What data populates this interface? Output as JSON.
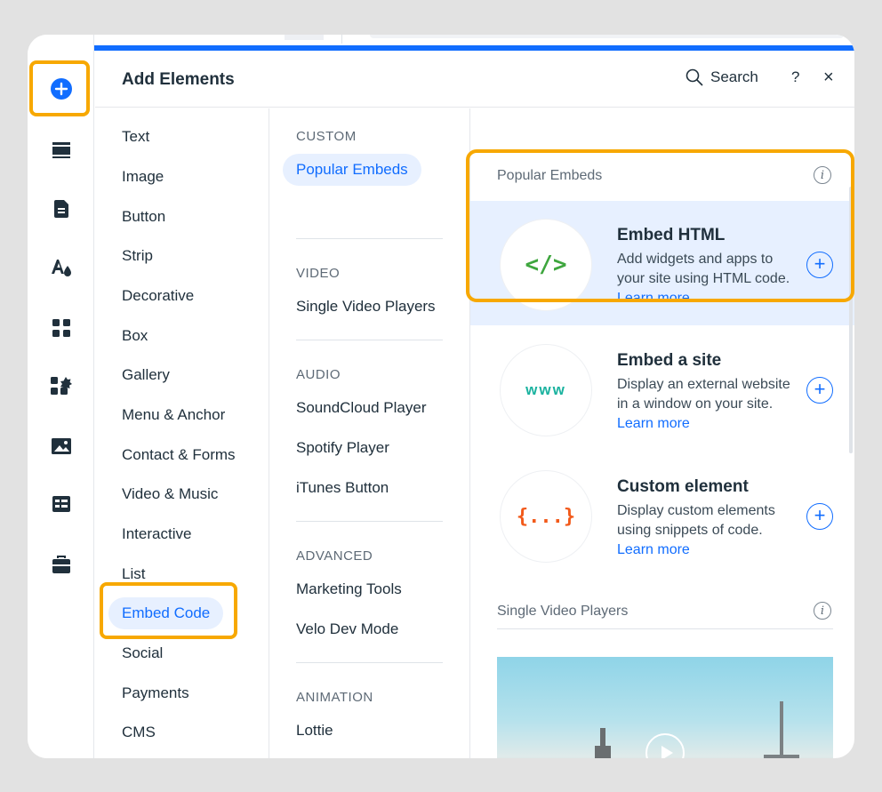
{
  "header": {
    "title": "Add Elements",
    "search_label": "Search",
    "help_label": "?",
    "close_label": "×"
  },
  "rail": [
    {
      "name": "add-icon"
    },
    {
      "name": "menus-icon"
    },
    {
      "name": "pages-icon"
    },
    {
      "name": "design-icon"
    },
    {
      "name": "apps-icon"
    },
    {
      "name": "add-apps-icon"
    },
    {
      "name": "media-icon"
    },
    {
      "name": "cms-icon"
    },
    {
      "name": "business-icon"
    }
  ],
  "categories": {
    "items": [
      "Text",
      "Image",
      "Button",
      "Strip",
      "Decorative",
      "Box",
      "Gallery",
      "Menu & Anchor",
      "Contact & Forms",
      "Video & Music",
      "Interactive",
      "List",
      "Embed Code",
      "Social",
      "Payments",
      "CMS"
    ],
    "active": "Embed Code"
  },
  "subcategories": {
    "custom": {
      "heading": "CUSTOM",
      "items": [
        "Popular Embeds"
      ]
    },
    "video": {
      "heading": "VIDEO",
      "items": [
        "Single Video Players"
      ]
    },
    "audio": {
      "heading": "AUDIO",
      "items": [
        "SoundCloud Player",
        "Spotify Player",
        "iTunes Button"
      ]
    },
    "advanced": {
      "heading": "ADVANCED",
      "items": [
        "Marketing Tools",
        "Velo Dev Mode"
      ]
    },
    "animation": {
      "heading": "ANIMATION",
      "items": [
        "Lottie"
      ]
    }
  },
  "content": {
    "section1_title": "Popular Embeds",
    "section2_title": "Single Video Players",
    "info_glyph": "i",
    "cards": [
      {
        "thumb": "</>",
        "title": "Embed HTML",
        "desc": "Add widgets and apps to your site using HTML code.",
        "link": "Learn more"
      },
      {
        "thumb": "www",
        "title": "Embed a site",
        "desc": "Display an external website in a window on your site.",
        "link": "Learn more"
      },
      {
        "thumb": "{...}",
        "title": "Custom element",
        "desc": "Display custom elements using snippets of code.",
        "link": "Learn more"
      }
    ]
  },
  "colors": {
    "accent": "#116dff",
    "highlight": "#f7a800",
    "active_bg": "#e7f0ff"
  }
}
